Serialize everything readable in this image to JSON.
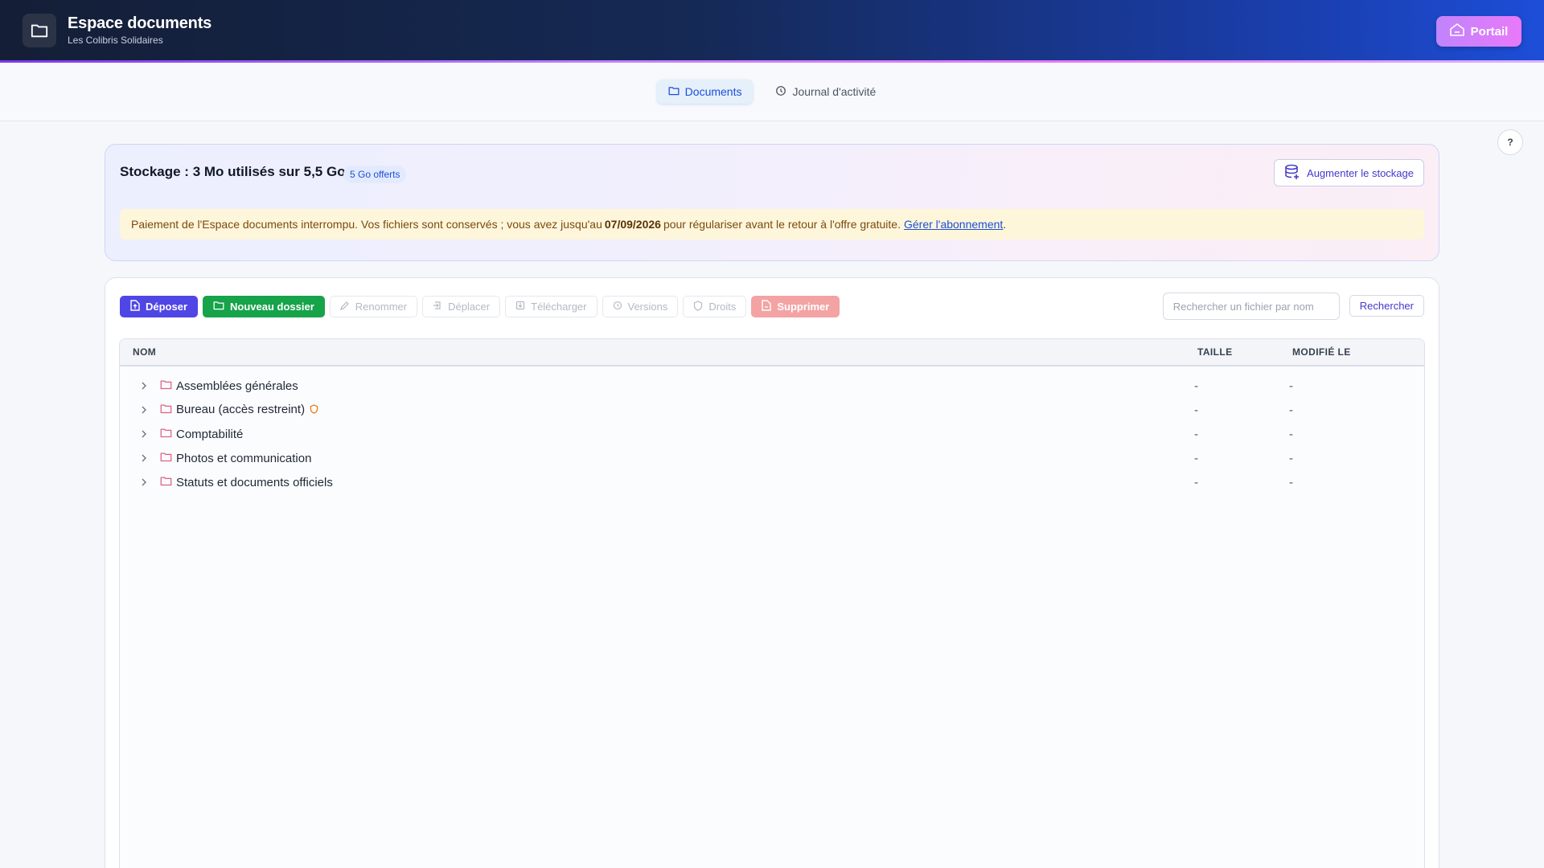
{
  "header": {
    "title": "Espace documents",
    "subtitle": "Les Colibris Solidaires",
    "portal_label": "Portail"
  },
  "tabs": [
    {
      "label": "Documents",
      "active": true
    },
    {
      "label": "Journal d'activité",
      "active": false
    }
  ],
  "help_label": "?",
  "storage": {
    "title": "Stockage : 3 Mo utilisés sur 5,5 Go",
    "badge": "5 Go offerts",
    "upgrade_label": "Augmenter le stockage",
    "notice_text": "Paiement de l'Espace documents interrompu. Vos fichiers sont conservés ; vous avez jusqu'au",
    "notice_date": "07/09/2026",
    "notice_text2": "pour régulariser avant le retour à l'offre gratuite.",
    "notice_link": "Gérer l'abonnement",
    "notice_end": "."
  },
  "toolbar": {
    "upload": "Déposer",
    "new_folder": "Nouveau dossier",
    "rename": "Renommer",
    "move": "Déplacer",
    "download": "Télécharger",
    "versions": "Versions",
    "rights": "Droits",
    "delete": "Supprimer"
  },
  "search": {
    "placeholder": "Rechercher un fichier par nom",
    "button": "Rechercher"
  },
  "table": {
    "columns": [
      "NOM",
      "TAILLE",
      "MODIFIÉ LE"
    ],
    "rows": [
      {
        "name": "Assemblées générales",
        "size": "-",
        "modified": "-",
        "restricted": false
      },
      {
        "name": "Bureau (accès restreint)",
        "size": "-",
        "modified": "-",
        "restricted": true
      },
      {
        "name": "Comptabilité",
        "size": "-",
        "modified": "-",
        "restricted": false
      },
      {
        "name": "Photos et communication",
        "size": "-",
        "modified": "-",
        "restricted": false
      },
      {
        "name": "Statuts et documents officiels",
        "size": "-",
        "modified": "-",
        "restricted": false
      }
    ]
  },
  "colors": {
    "primary": "#4f46e5",
    "success": "#16a34a",
    "danger": "#f3a3a3",
    "folder": "#e0607e"
  }
}
